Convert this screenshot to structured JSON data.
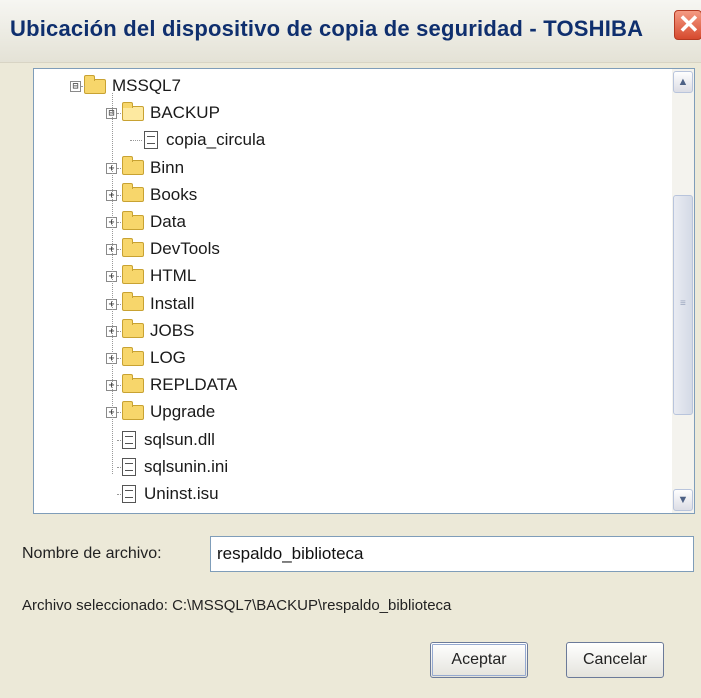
{
  "window": {
    "title": "Ubicación del dispositivo de copia de seguridad - TOSHIBA",
    "close_glyph": "✕"
  },
  "tree": {
    "items": [
      {
        "label": "MSSQL7",
        "icon": "folder-icon",
        "expander": "⊟",
        "level": 0
      },
      {
        "label": "BACKUP",
        "icon": "folder-open-icon",
        "expander": "⊟",
        "level": 1
      },
      {
        "label": "copia_circula",
        "icon": "file-icon",
        "expander": "",
        "level": 2
      },
      {
        "label": "Binn",
        "icon": "folder-icon",
        "expander": "+",
        "level": 1
      },
      {
        "label": "Books",
        "icon": "folder-icon",
        "expander": "+",
        "level": 1
      },
      {
        "label": "Data",
        "icon": "folder-icon",
        "expander": "+",
        "level": 1
      },
      {
        "label": "DevTools",
        "icon": "folder-icon",
        "expander": "+",
        "level": 1
      },
      {
        "label": "HTML",
        "icon": "folder-icon",
        "expander": "+",
        "level": 1
      },
      {
        "label": "Install",
        "icon": "folder-icon",
        "expander": "+",
        "level": 1
      },
      {
        "label": "JOBS",
        "icon": "folder-icon",
        "expander": "+",
        "level": 1
      },
      {
        "label": "LOG",
        "icon": "folder-icon",
        "expander": "+",
        "level": 1
      },
      {
        "label": "REPLDATA",
        "icon": "folder-icon",
        "expander": "+",
        "level": 1
      },
      {
        "label": "Upgrade",
        "icon": "folder-icon",
        "expander": "+",
        "level": 1
      },
      {
        "label": "sqlsun.dll",
        "icon": "file-icon",
        "expander": "",
        "level": 1
      },
      {
        "label": "sqlsunin.ini",
        "icon": "file-icon",
        "expander": "",
        "level": 1
      },
      {
        "label": "Uninst.isu",
        "icon": "file-icon",
        "expander": "",
        "level": 1
      }
    ],
    "scroll_up_glyph": "▲",
    "scroll_down_glyph": "▼",
    "thumb_grip": "≡"
  },
  "form": {
    "filename_label": "Nombre de archivo:",
    "filename_value": "respaldo_biblioteca",
    "selected_label": "Archivo seleccionado: C:\\MSSQL7\\BACKUP\\respaldo_biblioteca"
  },
  "buttons": {
    "accept": "Aceptar",
    "cancel": "Cancelar"
  },
  "colors": {
    "dialog_bg": "#ece9d8",
    "title_text": "#0f2f6e",
    "close_button": "#d64a2e",
    "folder": "#f7d66b"
  }
}
